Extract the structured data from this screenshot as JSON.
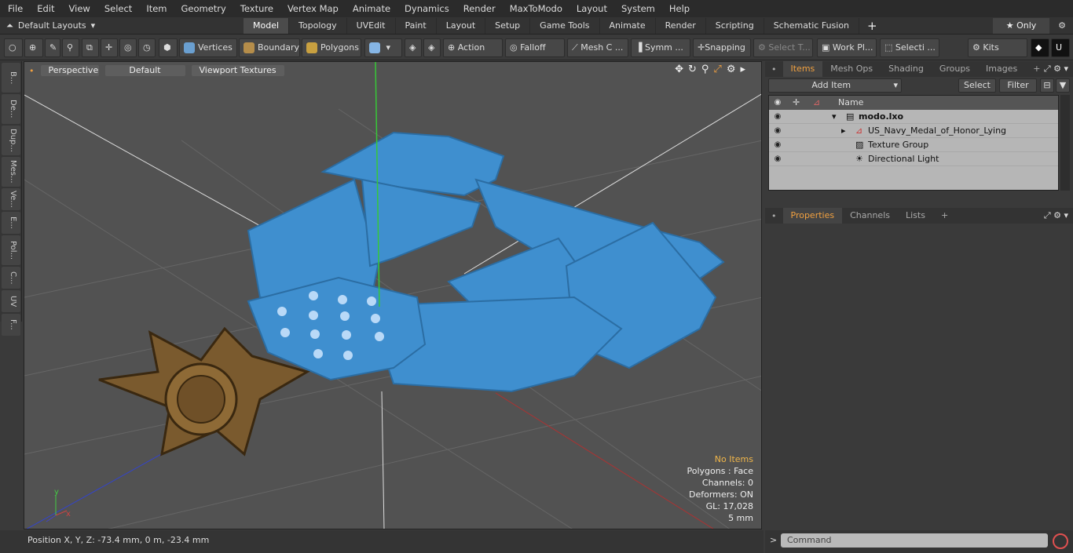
{
  "menu": [
    "File",
    "Edit",
    "View",
    "Select",
    "Item",
    "Geometry",
    "Texture",
    "Vertex Map",
    "Animate",
    "Dynamics",
    "Render",
    "MaxToModo",
    "Layout",
    "System",
    "Help"
  ],
  "layouts": {
    "label": "Default Layouts"
  },
  "tabs": [
    "Model",
    "Topology",
    "UVEdit",
    "Paint",
    "Layout",
    "Setup",
    "Game Tools",
    "Animate",
    "Render",
    "Scripting",
    "Schematic Fusion"
  ],
  "only_label": "Only",
  "toolbar": {
    "vertices": "Vertices",
    "boundary": "Boundary",
    "polygons": "Polygons",
    "action": "Action",
    "falloff": "Falloff",
    "mesh": "Mesh C ...",
    "symm": "Symm ...",
    "snapping": "Snapping",
    "select_t": "Select T...",
    "work_pl": "Work Pl...",
    "selecti": "Selecti ...",
    "kits": "Kits"
  },
  "left_strip": [
    "B...",
    "De...",
    "Dup...",
    "Mes...",
    "Ve...",
    "E...",
    "Pol...",
    "C...",
    "UV",
    "F..."
  ],
  "viewport": {
    "view": "Perspective",
    "shading": "Default",
    "textures": "Viewport Textures"
  },
  "info": {
    "no_items": "No Items",
    "polygons": "Polygons : Face",
    "channels": "Channels: 0",
    "deformers": "Deformers: ON",
    "gl": "GL: 17,028",
    "scale": "5 mm"
  },
  "status": "Position X, Y, Z:   -73.4 mm, 0 m, -23.4 mm",
  "panel_tabs": [
    "Items",
    "Mesh Ops",
    "Shading",
    "Groups",
    "Images"
  ],
  "panel_buttons": {
    "add": "Add Item",
    "select": "Select",
    "filter": "Filter"
  },
  "tree": {
    "header": "Name",
    "rows": [
      "modo.lxo",
      "US_Navy_Medal_of_Honor_Lying",
      "Texture Group",
      "Directional Light"
    ]
  },
  "props_tabs": [
    "Properties",
    "Channels",
    "Lists"
  ],
  "command_placeholder": "Command",
  "colors": {
    "ribbon": "#3f8fcf",
    "medal": "#7a5a2e",
    "accent": "#f0a040"
  }
}
